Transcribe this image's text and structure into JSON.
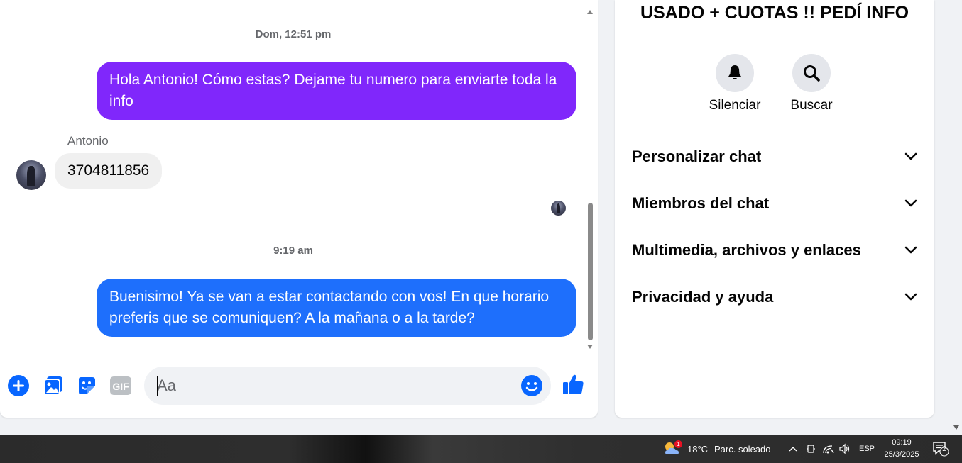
{
  "chat": {
    "timestamps": [
      "Dom, 12:51 pm",
      "9:19 am"
    ],
    "messages": [
      {
        "sender": "me",
        "text": "Hola Antonio! Cómo estas? Dejame tu numero para enviarte toda la info"
      },
      {
        "sender": "Antonio",
        "text": "3704811856"
      },
      {
        "sender": "me",
        "text": "Buenisimo! Ya se van a estar contactando con vos! En que horario preferis que se comuniquen? A la mañana o a la tarde?"
      }
    ],
    "sender_name": "Antonio"
  },
  "composer": {
    "placeholder": "Aa",
    "icons": [
      "plus-icon",
      "photo-icon",
      "sticker-icon",
      "gif-icon",
      "emoji-icon",
      "like-icon"
    ],
    "gif_label": "GIF"
  },
  "info": {
    "title": "USADO + CUOTAS !! PEDÍ INFO",
    "actions": [
      {
        "label": "Silenciar",
        "icon": "bell-icon"
      },
      {
        "label": "Buscar",
        "icon": "search-icon"
      }
    ],
    "sections": [
      {
        "label": "Personalizar chat"
      },
      {
        "label": "Miembros del chat"
      },
      {
        "label": "Multimedia, archivos y enlaces"
      },
      {
        "label": "Privacidad y ayuda"
      }
    ]
  },
  "taskbar": {
    "weather_temp": "18°C",
    "weather_text": "Parc. soleado",
    "weather_badge": "1",
    "language": "ESP",
    "time": "09:19",
    "date": "25/3/2025",
    "notifications": "2"
  },
  "colors": {
    "bubble_purple": "#8027fb",
    "bubble_blue": "#1e6ffc",
    "accent": "#0866ff"
  }
}
